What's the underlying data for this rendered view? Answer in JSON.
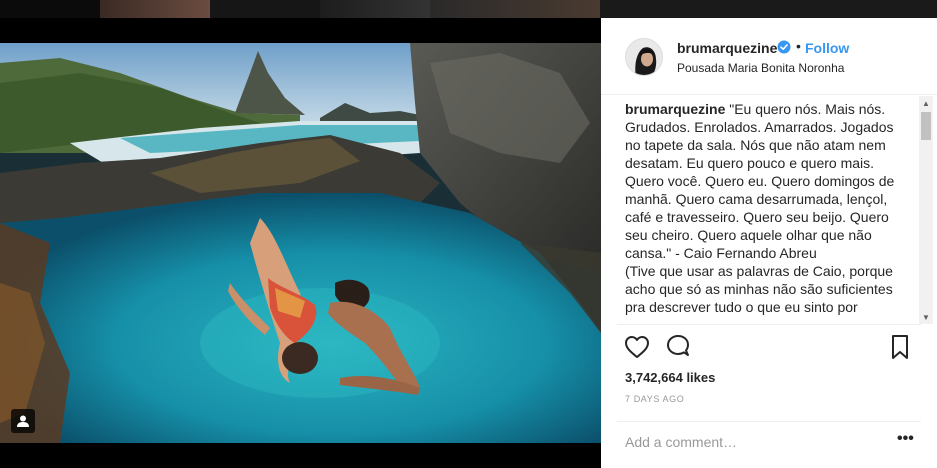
{
  "post": {
    "username": "brumarquezine",
    "follow_label": "Follow",
    "dot": "•",
    "location": "Pousada Maria Bonita Noronha",
    "caption_lines": [
      "\"Eu quero nós. Mais nós.",
      "Grudados. Enrolados. Amarrados. Jogados",
      "no tapete da sala. Nós que não atam nem",
      "desatam. Eu quero pouco e quero mais.",
      "Quero você. Quero eu. Quero domingos de",
      "manhã. Quero cama desarrumada, lençol,",
      "café e travesseiro. Quero seu beijo. Quero",
      "seu cheiro. Quero aquele olhar que não",
      "cansa.\" - Caio Fernando Abreu",
      "(Tive que usar as palavras de Caio, porque",
      "acho que só as minhas não são suficientes",
      "pra descrever tudo o que eu sinto por"
    ],
    "likes": "3,742,664 likes",
    "time": "7 DAYS AGO",
    "comment_placeholder": "Add a comment…",
    "more_label": "•••"
  },
  "icons": {
    "verified": "verified-badge-icon",
    "heart": "heart-icon",
    "comment": "comment-icon",
    "save": "bookmark-icon",
    "tagged": "user-tag-icon",
    "scroll_up": "▲",
    "scroll_down": "▼"
  },
  "colors": {
    "accent": "#3897f0",
    "text": "#262626",
    "muted": "#999999",
    "divider": "#efefef"
  }
}
